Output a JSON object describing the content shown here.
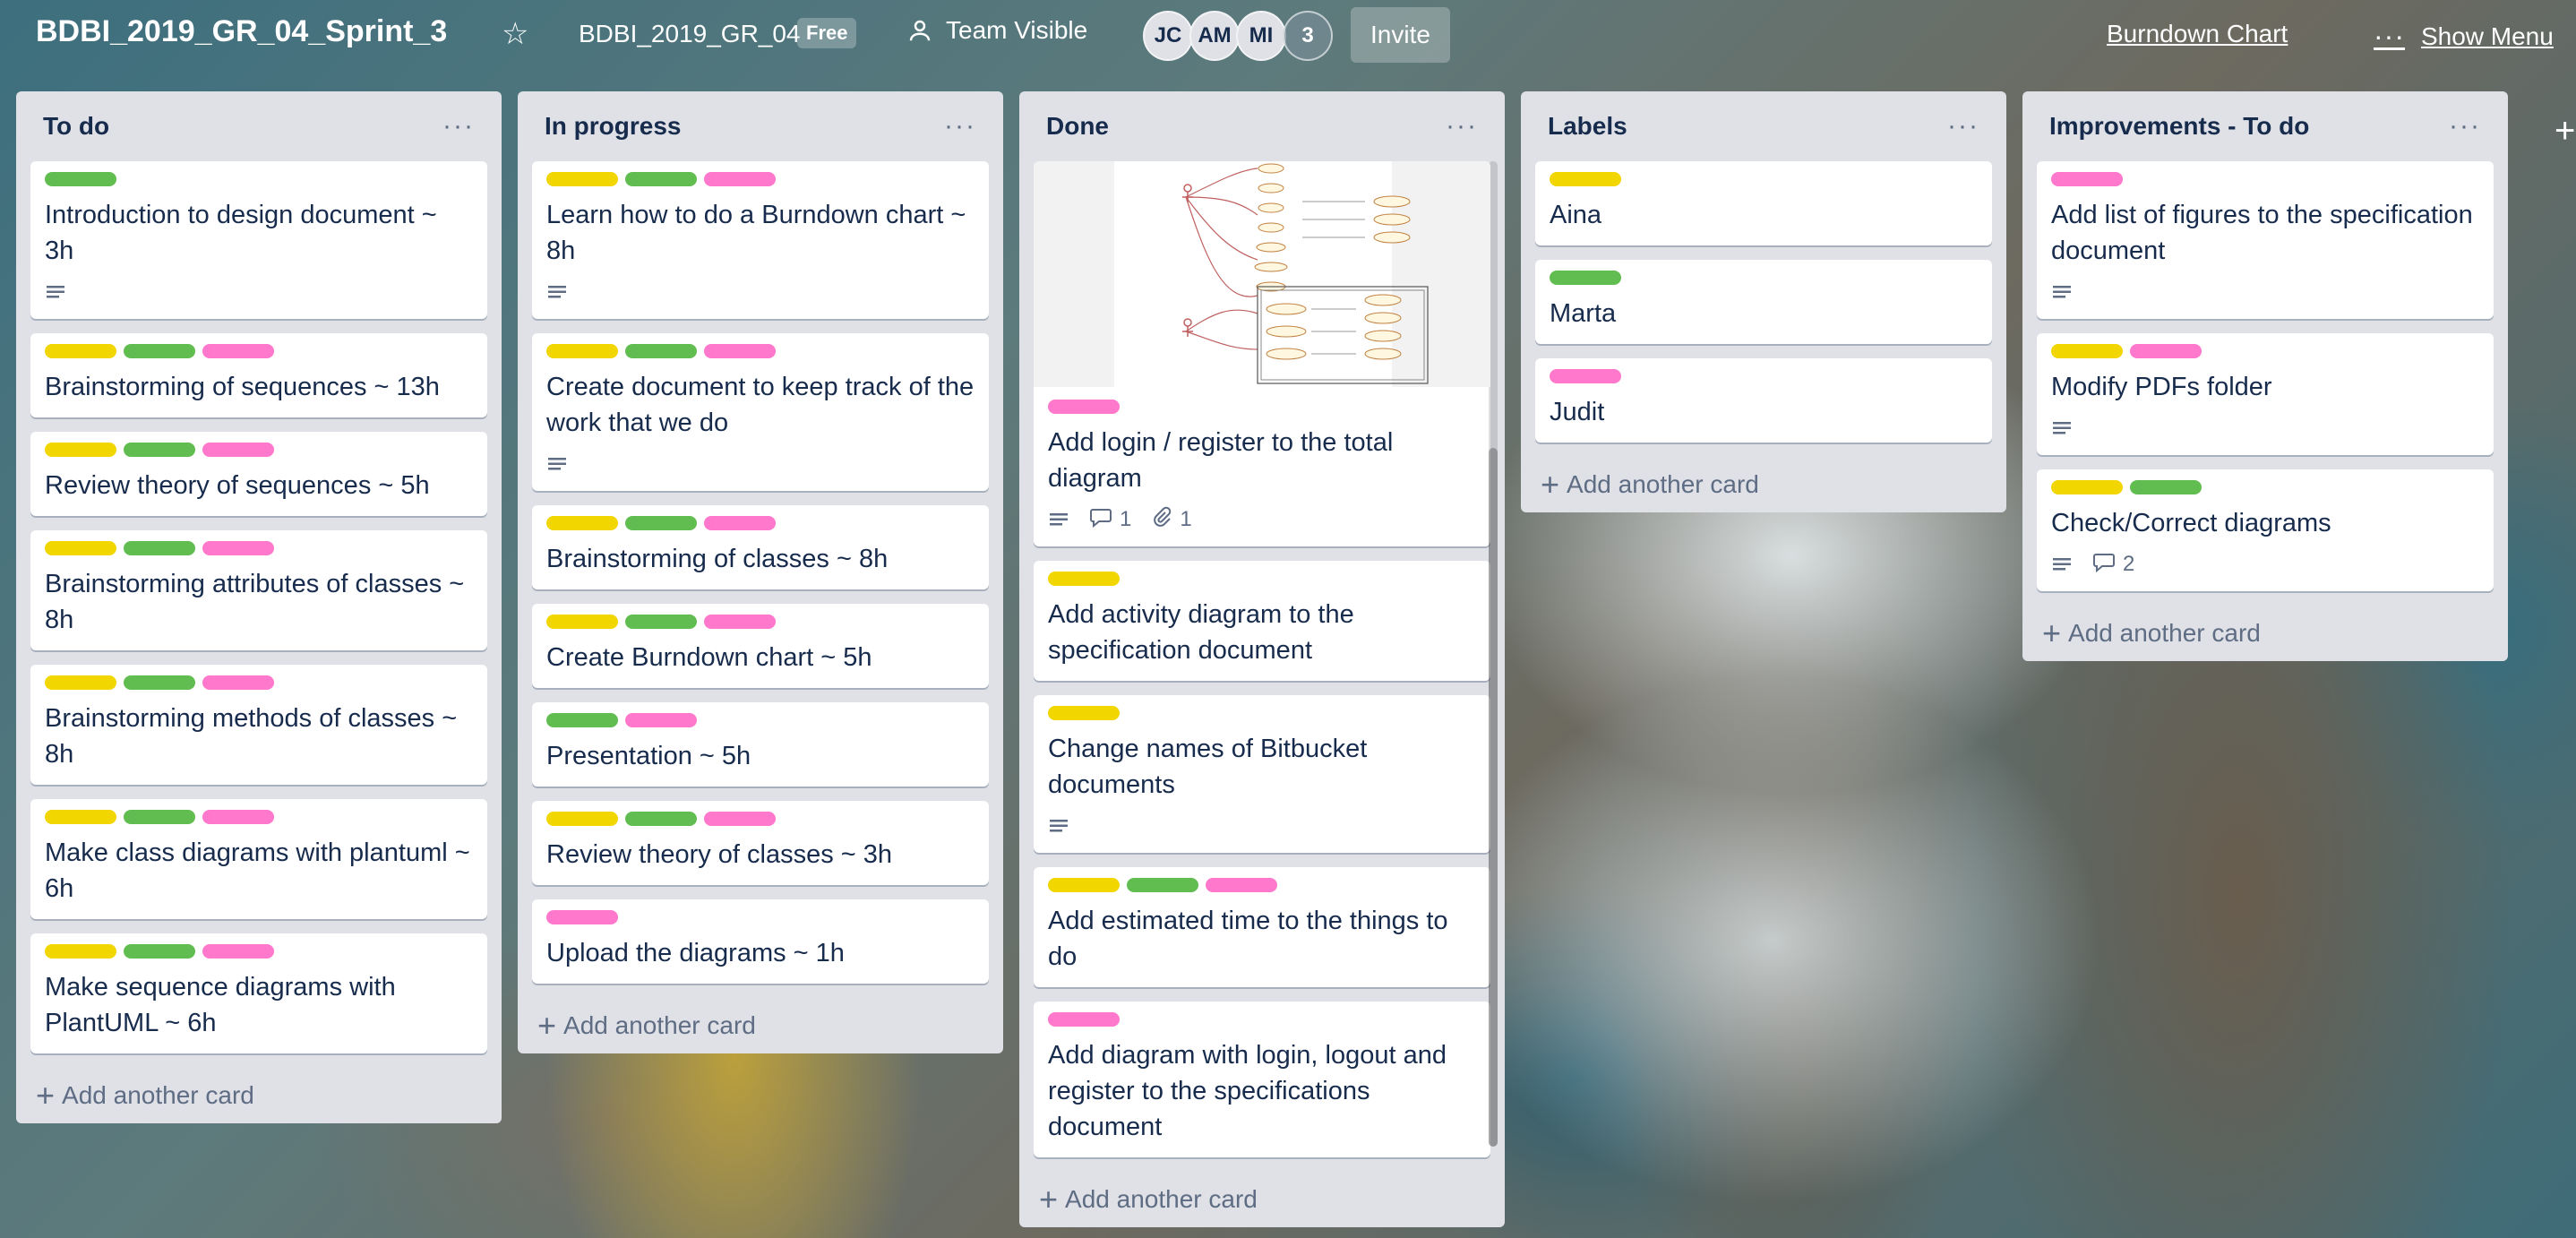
{
  "header": {
    "board_title": "BDBI_2019_GR_04_Sprint_3",
    "team_name": "BDBI_2019_GR_04",
    "plan_badge": "Free",
    "visibility": "Team Visible",
    "members": [
      "JC",
      "AM",
      "MI"
    ],
    "member_overflow": "3",
    "invite": "Invite",
    "burndown": "Burndown Chart",
    "show_menu": "Show Menu"
  },
  "colors": {
    "yellow": "#f2d600",
    "green": "#61bd4f",
    "pink": "#ff78cb"
  },
  "lists": [
    {
      "title": "To do",
      "add_card": "Add another card",
      "cards": [
        {
          "labels": [
            "green"
          ],
          "title": "Introduction to design document ~ 3h",
          "description": true
        },
        {
          "labels": [
            "yellow",
            "green",
            "pink"
          ],
          "title": "Brainstorming of sequences ~ 13h"
        },
        {
          "labels": [
            "yellow",
            "green",
            "pink"
          ],
          "title": "Review theory of sequences ~ 5h"
        },
        {
          "labels": [
            "yellow",
            "green",
            "pink"
          ],
          "title": "Brainstorming attributes of classes ~ 8h"
        },
        {
          "labels": [
            "yellow",
            "green",
            "pink"
          ],
          "title": "Brainstorming methods of classes ~ 8h"
        },
        {
          "labels": [
            "yellow",
            "green",
            "pink"
          ],
          "title": "Make class diagrams with plantuml ~ 6h"
        },
        {
          "labels": [
            "yellow",
            "green",
            "pink"
          ],
          "title": "Make sequence diagrams with PlantUML ~ 6h"
        }
      ]
    },
    {
      "title": "In progress",
      "add_card": "Add another card",
      "cards": [
        {
          "labels": [
            "yellow",
            "green",
            "pink"
          ],
          "title": "Learn how to do a Burndown chart ~ 8h",
          "description": true
        },
        {
          "labels": [
            "yellow",
            "green",
            "pink"
          ],
          "title": "Create document to keep track of the work that we do",
          "description": true
        },
        {
          "labels": [
            "yellow",
            "green",
            "pink"
          ],
          "title": "Brainstorming of classes ~ 8h"
        },
        {
          "labels": [
            "yellow",
            "green",
            "pink"
          ],
          "title": "Create Burndown chart ~ 5h"
        },
        {
          "labels": [
            "green",
            "pink"
          ],
          "title": "Presentation ~ 5h"
        },
        {
          "labels": [
            "yellow",
            "green",
            "pink"
          ],
          "title": "Review theory of classes ~ 3h"
        },
        {
          "labels": [
            "pink"
          ],
          "title": "Upload the diagrams ~ 1h"
        }
      ]
    },
    {
      "title": "Done",
      "add_card": "Add another card",
      "cards": [
        {
          "labels": [
            "pink"
          ],
          "title": "Add login / register to the total diagram",
          "description": true,
          "comments": "1",
          "attachments": "1",
          "cover": true
        },
        {
          "labels": [
            "yellow"
          ],
          "title": "Add activity diagram to the specification document"
        },
        {
          "labels": [
            "yellow"
          ],
          "title": "Change names of Bitbucket documents",
          "description": true
        },
        {
          "labels": [
            "yellow",
            "green",
            "pink"
          ],
          "title": "Add estimated time to the things to do"
        },
        {
          "labels": [
            "pink"
          ],
          "title": "Add diagram with login, logout and register to the specifications document"
        }
      ]
    },
    {
      "title": "Labels",
      "add_card": "Add another card",
      "cards": [
        {
          "labels": [
            "yellow"
          ],
          "title": "Aina"
        },
        {
          "labels": [
            "green"
          ],
          "title": "Marta"
        },
        {
          "labels": [
            "pink"
          ],
          "title": "Judit"
        }
      ]
    },
    {
      "title": "Improvements - To do",
      "add_card": "Add another card",
      "cards": [
        {
          "labels": [
            "pink"
          ],
          "title": "Add list of figures to the specification document",
          "description": true
        },
        {
          "labels": [
            "yellow",
            "pink"
          ],
          "title": "Modify PDFs folder",
          "description": true
        },
        {
          "labels": [
            "yellow",
            "green"
          ],
          "title": "Check/Correct diagrams",
          "description": true,
          "comments": "2"
        }
      ]
    }
  ]
}
